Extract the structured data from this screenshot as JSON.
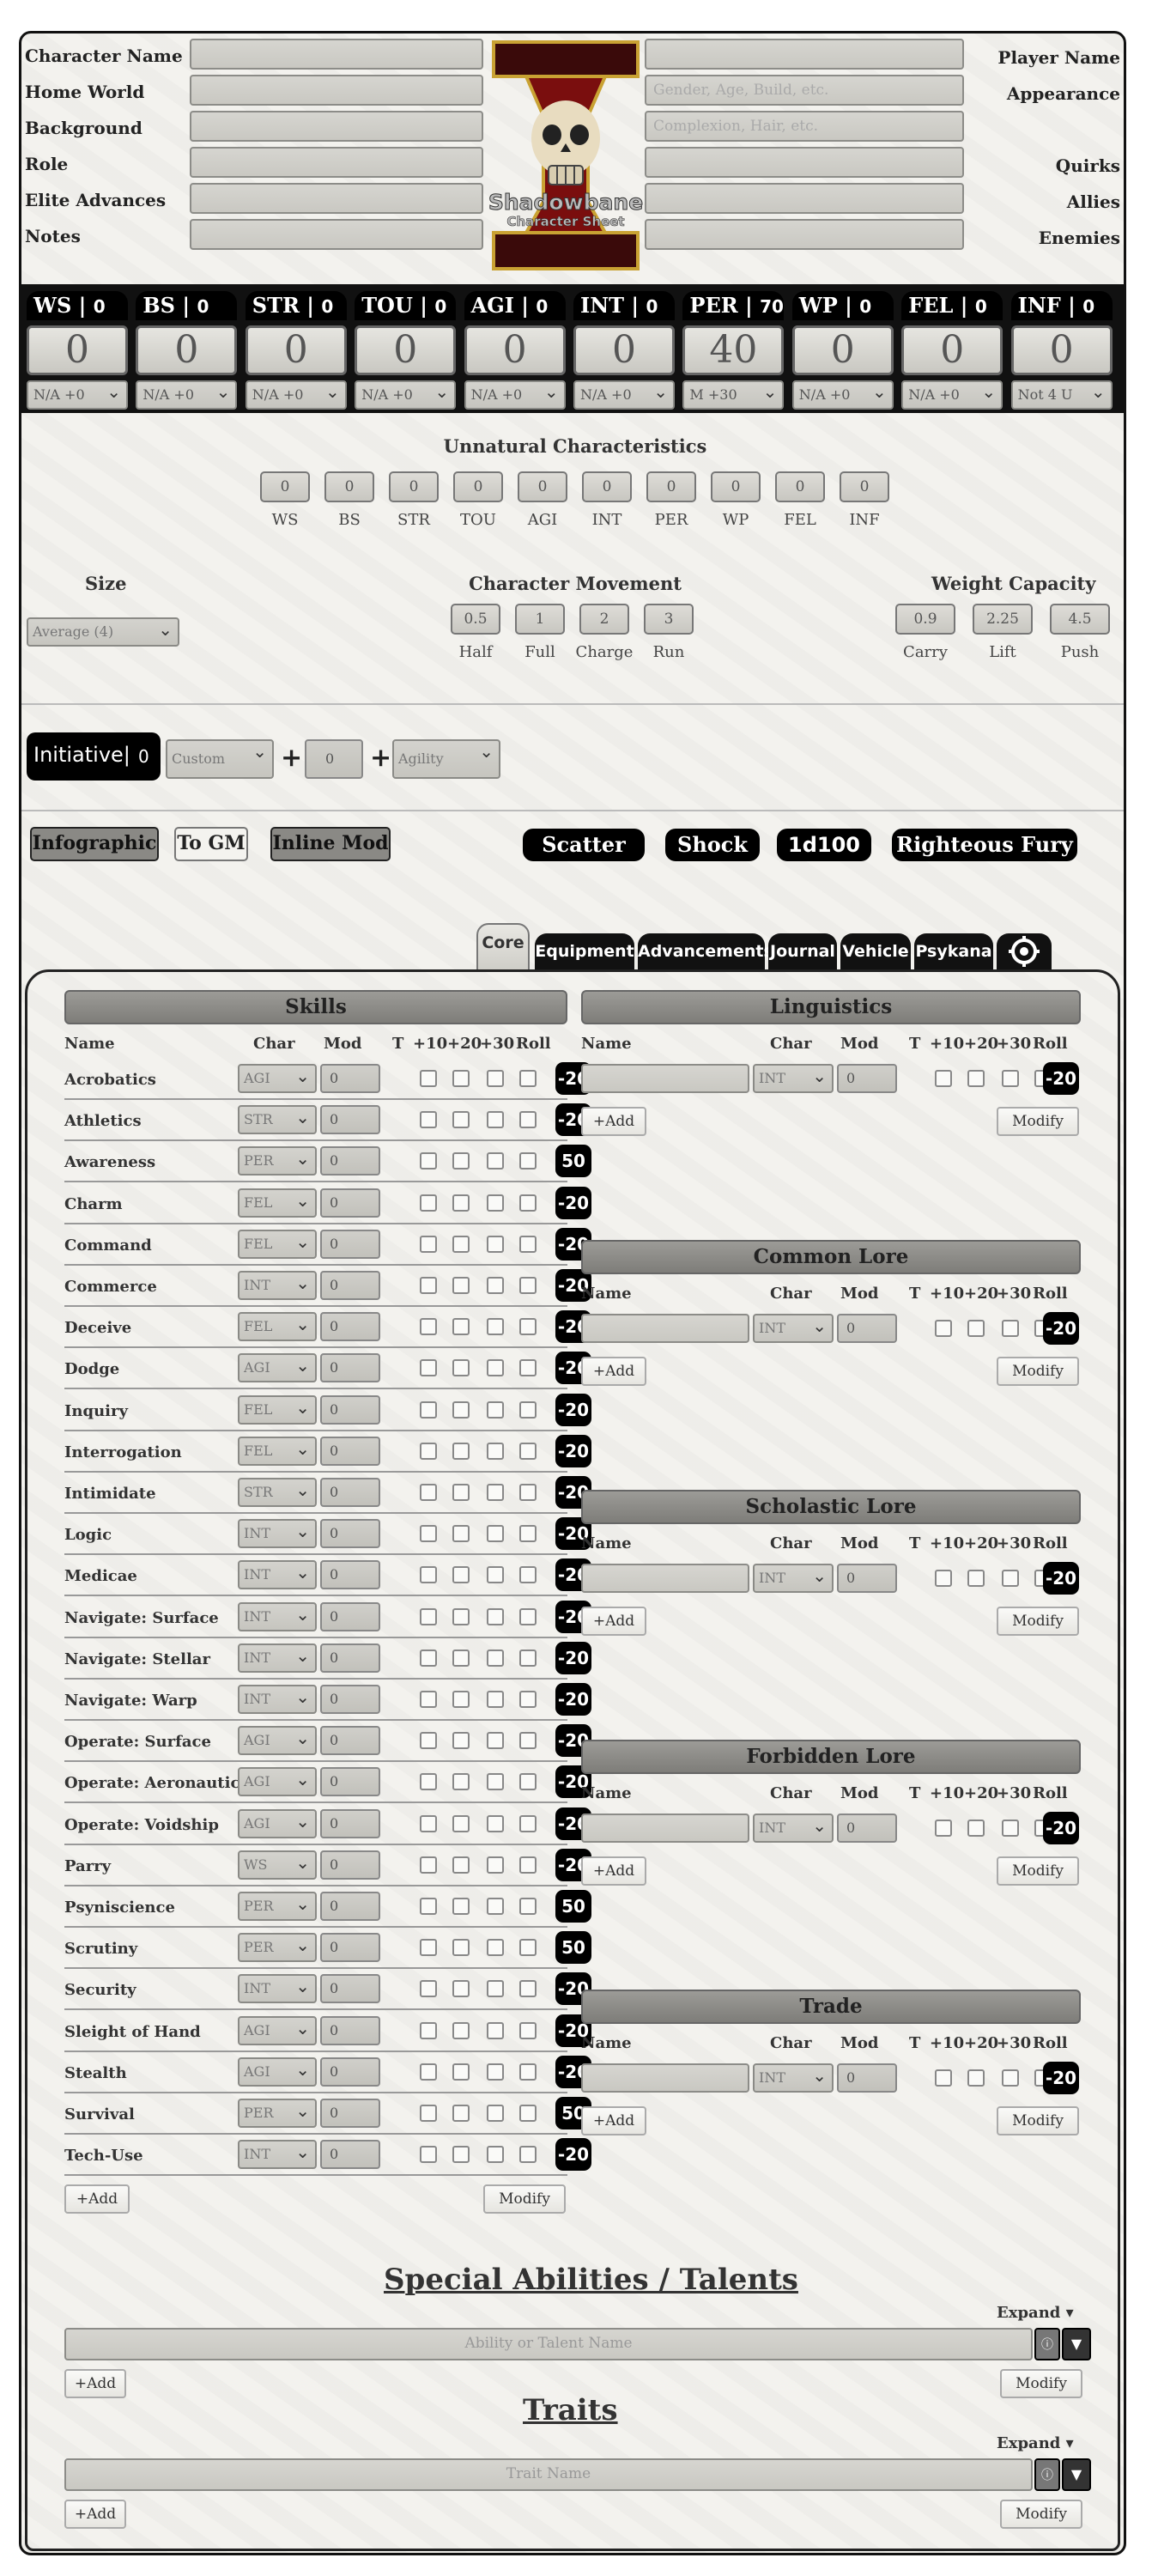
{
  "header": {
    "left_labels": [
      "Character Name",
      "Home World",
      "Background",
      "Role",
      "Elite Advances",
      "Notes"
    ],
    "right_labels": [
      "Player Name",
      "Appearance",
      "",
      "Quirks",
      "Allies",
      "Enemies"
    ],
    "right_placeholders": [
      "",
      "Gender, Age, Build, etc.",
      "Complexion, Hair, etc.",
      "",
      "",
      ""
    ],
    "logo_text": "Shadowbane",
    "logo_subtitle": "Character Sheet"
  },
  "characteristics": [
    {
      "abbr": "WS",
      "bonus": "0",
      "value": "0",
      "select": "N/A +0"
    },
    {
      "abbr": "BS",
      "bonus": "0",
      "value": "0",
      "select": "N/A +0"
    },
    {
      "abbr": "STR",
      "bonus": "0",
      "value": "0",
      "select": "N/A +0"
    },
    {
      "abbr": "TOU",
      "bonus": "0",
      "value": "0",
      "select": "N/A +0"
    },
    {
      "abbr": "AGI",
      "bonus": "0",
      "value": "0",
      "select": "N/A +0"
    },
    {
      "abbr": "INT",
      "bonus": "0",
      "value": "0",
      "select": "N/A +0"
    },
    {
      "abbr": "PER",
      "bonus": "70",
      "value": "40",
      "select": "M +30"
    },
    {
      "abbr": "WP",
      "bonus": "0",
      "value": "0",
      "select": "N/A +0"
    },
    {
      "abbr": "FEL",
      "bonus": "0",
      "value": "0",
      "select": "N/A +0"
    },
    {
      "abbr": "INF",
      "bonus": "0",
      "value": "0",
      "select": "Not 4 U"
    }
  ],
  "unnatural": {
    "title": "Unnatural Characteristics",
    "items": [
      {
        "label": "WS",
        "value": "0"
      },
      {
        "label": "BS",
        "value": "0"
      },
      {
        "label": "STR",
        "value": "0"
      },
      {
        "label": "TOU",
        "value": "0"
      },
      {
        "label": "AGI",
        "value": "0"
      },
      {
        "label": "INT",
        "value": "0"
      },
      {
        "label": "PER",
        "value": "0"
      },
      {
        "label": "WP",
        "value": "0"
      },
      {
        "label": "FEL",
        "value": "0"
      },
      {
        "label": "INF",
        "value": "0"
      }
    ]
  },
  "size": {
    "title": "Size",
    "value": "Average (4)"
  },
  "movement": {
    "title": "Character Movement",
    "items": [
      {
        "label": "Half",
        "value": "0.5"
      },
      {
        "label": "Full",
        "value": "1"
      },
      {
        "label": "Charge",
        "value": "2"
      },
      {
        "label": "Run",
        "value": "3"
      }
    ]
  },
  "weight": {
    "title": "Weight Capacity",
    "items": [
      {
        "label": "Carry",
        "value": "0.9"
      },
      {
        "label": "Lift",
        "value": "2.25"
      },
      {
        "label": "Push",
        "value": "4.5"
      }
    ]
  },
  "initiative": {
    "label": "Initiative|",
    "value": "0",
    "custom": "Custom",
    "plus": "+",
    "mod": "0",
    "agility": "Agility"
  },
  "toggles": {
    "infographic": "Infographic",
    "to_gm": "To GM",
    "inline_mod": "Inline Mod"
  },
  "rolls": {
    "scatter": "Scatter",
    "shock": "Shock",
    "d100": "1d100",
    "fury": "Righteous Fury"
  },
  "tabs": [
    "Core",
    "Equipment",
    "Advancements",
    "Journal",
    "Vehicle",
    "Psykana"
  ],
  "columns": {
    "name": "Name",
    "char": "Char",
    "mod": "Mod",
    "t": "T",
    "p10": "+10",
    "p20": "+20",
    "p30": "+30",
    "roll": "Roll"
  },
  "skills": {
    "title": "Skills",
    "rows": [
      {
        "name": "Acrobatics",
        "char": "AGI",
        "mod": "0",
        "roll": "-20"
      },
      {
        "name": "Athletics",
        "char": "STR",
        "mod": "0",
        "roll": "-20"
      },
      {
        "name": "Awareness",
        "char": "PER",
        "mod": "0",
        "roll": "50"
      },
      {
        "name": "Charm",
        "char": "FEL",
        "mod": "0",
        "roll": "-20"
      },
      {
        "name": "Command",
        "char": "FEL",
        "mod": "0",
        "roll": "-20"
      },
      {
        "name": "Commerce",
        "char": "INT",
        "mod": "0",
        "roll": "-20"
      },
      {
        "name": "Deceive",
        "char": "FEL",
        "mod": "0",
        "roll": "-20"
      },
      {
        "name": "Dodge",
        "char": "AGI",
        "mod": "0",
        "roll": "-20"
      },
      {
        "name": "Inquiry",
        "char": "FEL",
        "mod": "0",
        "roll": "-20"
      },
      {
        "name": "Interrogation",
        "char": "FEL",
        "mod": "0",
        "roll": "-20"
      },
      {
        "name": "Intimidate",
        "char": "STR",
        "mod": "0",
        "roll": "-20"
      },
      {
        "name": "Logic",
        "char": "INT",
        "mod": "0",
        "roll": "-20"
      },
      {
        "name": "Medicae",
        "char": "INT",
        "mod": "0",
        "roll": "-20"
      },
      {
        "name": "Navigate: Surface",
        "char": "INT",
        "mod": "0",
        "roll": "-20"
      },
      {
        "name": "Navigate: Stellar",
        "char": "INT",
        "mod": "0",
        "roll": "-20"
      },
      {
        "name": "Navigate: Warp",
        "char": "INT",
        "mod": "0",
        "roll": "-20"
      },
      {
        "name": "Operate: Surface",
        "char": "AGI",
        "mod": "0",
        "roll": "-20"
      },
      {
        "name": "Operate: Aeronautica",
        "char": "AGI",
        "mod": "0",
        "roll": "-20"
      },
      {
        "name": "Operate: Voidship",
        "char": "AGI",
        "mod": "0",
        "roll": "-20"
      },
      {
        "name": "Parry",
        "char": "WS",
        "mod": "0",
        "roll": "-20"
      },
      {
        "name": "Psyniscience",
        "char": "PER",
        "mod": "0",
        "roll": "50"
      },
      {
        "name": "Scrutiny",
        "char": "PER",
        "mod": "0",
        "roll": "50"
      },
      {
        "name": "Security",
        "char": "INT",
        "mod": "0",
        "roll": "-20"
      },
      {
        "name": "Sleight of Hand",
        "char": "AGI",
        "mod": "0",
        "roll": "-20"
      },
      {
        "name": "Stealth",
        "char": "AGI",
        "mod": "0",
        "roll": "-20"
      },
      {
        "name": "Survival",
        "char": "PER",
        "mod": "0",
        "roll": "50"
      },
      {
        "name": "Tech-Use",
        "char": "INT",
        "mod": "0",
        "roll": "-20"
      }
    ]
  },
  "lore_sections": [
    {
      "title": "Linguistics",
      "char": "INT",
      "mod": "0",
      "roll": "-20"
    },
    {
      "title": "Common Lore",
      "char": "INT",
      "mod": "0",
      "roll": "-20"
    },
    {
      "title": "Scholastic Lore",
      "char": "INT",
      "mod": "0",
      "roll": "-20"
    },
    {
      "title": "Forbidden Lore",
      "char": "INT",
      "mod": "0",
      "roll": "-20"
    },
    {
      "title": "Trade",
      "char": "INT",
      "mod": "0",
      "roll": "-20"
    }
  ],
  "buttons": {
    "add": "+Add",
    "modify": "Modify",
    "expand": "Expand ▾"
  },
  "talents": {
    "title": "Special Abilities / Talents",
    "placeholder": "Ability or Talent Name"
  },
  "traits": {
    "title": "Traits",
    "placeholder": "Trait Name"
  }
}
